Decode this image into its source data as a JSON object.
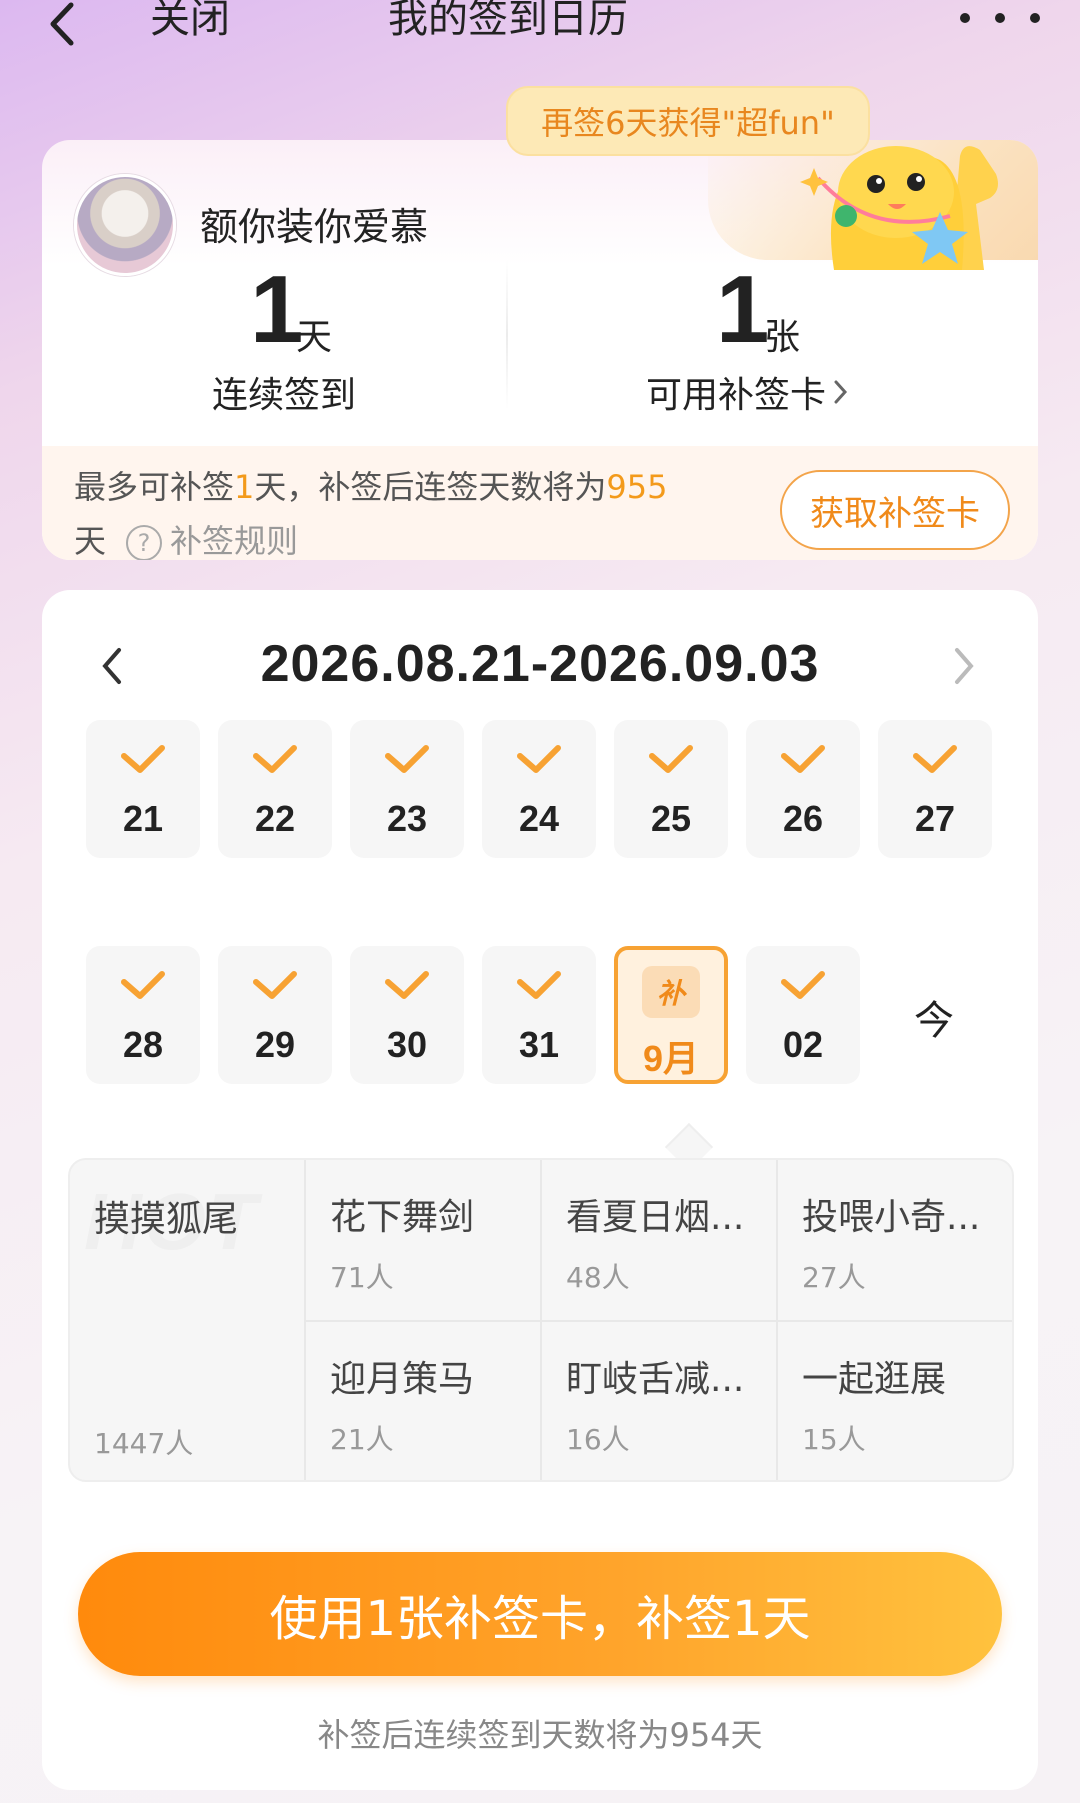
{
  "nav": {
    "close_label": "关闭",
    "title": "我的签到日历",
    "back_icon": "chevron-left-icon",
    "more_icon": "more-icon"
  },
  "profile": {
    "bubble": "再签6天获得\"超fun\"",
    "username": "额你装你爱慕",
    "streak_value": "1",
    "streak_unit": "天",
    "streak_label": "连续签到",
    "cards_value": "1",
    "cards_unit": "张",
    "cards_label": "可用补签卡",
    "info_prefix": "最多可补签",
    "info_days": "1",
    "info_mid": "天，补签后连签天数将为",
    "info_total": "955",
    "info_suffix": "天",
    "rules_label": "补签规则",
    "get_card_button": "获取补签卡",
    "accent": "#f39a1b"
  },
  "calendar": {
    "range": "2026.08.21-2026.09.03",
    "row1": [
      {
        "day": "21",
        "checked": true
      },
      {
        "day": "22",
        "checked": true
      },
      {
        "day": "23",
        "checked": true
      },
      {
        "day": "24",
        "checked": true
      },
      {
        "day": "25",
        "checked": true
      },
      {
        "day": "26",
        "checked": true
      },
      {
        "day": "27",
        "checked": true
      }
    ],
    "row2": [
      {
        "day": "28",
        "checked": true
      },
      {
        "day": "29",
        "checked": true
      },
      {
        "day": "30",
        "checked": true
      },
      {
        "day": "31",
        "checked": true
      },
      {
        "day": "9月",
        "selected": true,
        "badge": "补"
      },
      {
        "day": "02",
        "checked": true
      }
    ],
    "today_label": "今"
  },
  "topics": {
    "watermark": "HOT",
    "featured": {
      "name": "摸摸狐尾",
      "count": "1447人"
    },
    "items": [
      {
        "name": "花下舞剑",
        "count": "71人"
      },
      {
        "name": "看夏日烟...",
        "count": "48人"
      },
      {
        "name": "投喂小奇...",
        "count": "27人"
      },
      {
        "name": "迎月策马",
        "count": "21人"
      },
      {
        "name": "盯岐舌减...",
        "count": "16人"
      },
      {
        "name": "一起逛展",
        "count": "15人"
      }
    ]
  },
  "action": {
    "use_button": "使用1张补签卡，补签1天",
    "after_note": "补签后连续签到天数将为954天",
    "button_color": "#ff8a0c"
  }
}
